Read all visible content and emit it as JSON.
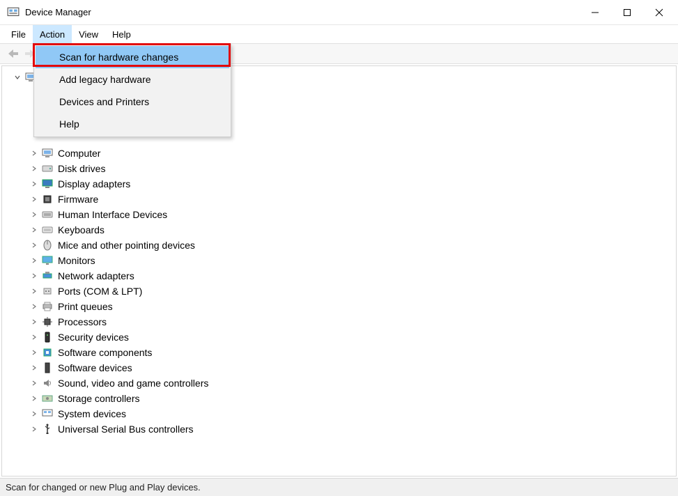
{
  "window": {
    "title": "Device Manager"
  },
  "menubar": {
    "items": [
      "File",
      "Action",
      "View",
      "Help"
    ],
    "active_index": 1
  },
  "dropdown": {
    "items": [
      {
        "label": "Scan for hardware changes",
        "highlighted": true
      },
      {
        "label": "Add legacy hardware",
        "highlighted": false
      },
      {
        "label": "Devices and Printers",
        "highlighted": false
      },
      {
        "label": "Help",
        "highlighted": false
      }
    ]
  },
  "tree": {
    "root": {
      "label": ""
    },
    "nodes": [
      {
        "label": "",
        "hidden": true
      },
      {
        "label": "",
        "hidden": true
      },
      {
        "label": "",
        "hidden": true
      },
      {
        "label": "",
        "hidden": true
      },
      {
        "label": "Computer",
        "icon": "computer"
      },
      {
        "label": "Disk drives",
        "icon": "disk"
      },
      {
        "label": "Display adapters",
        "icon": "display"
      },
      {
        "label": "Firmware",
        "icon": "firmware"
      },
      {
        "label": "Human Interface Devices",
        "icon": "hid"
      },
      {
        "label": "Keyboards",
        "icon": "keyboard"
      },
      {
        "label": "Mice and other pointing devices",
        "icon": "mouse"
      },
      {
        "label": "Monitors",
        "icon": "monitor"
      },
      {
        "label": "Network adapters",
        "icon": "network"
      },
      {
        "label": "Ports (COM & LPT)",
        "icon": "port"
      },
      {
        "label": "Print queues",
        "icon": "printer"
      },
      {
        "label": "Processors",
        "icon": "cpu"
      },
      {
        "label": "Security devices",
        "icon": "security"
      },
      {
        "label": "Software components",
        "icon": "software"
      },
      {
        "label": "Software devices",
        "icon": "software2"
      },
      {
        "label": "Sound, video and game controllers",
        "icon": "sound"
      },
      {
        "label": "Storage controllers",
        "icon": "storage"
      },
      {
        "label": "System devices",
        "icon": "system"
      },
      {
        "label": "Universal Serial Bus controllers",
        "icon": "usb"
      }
    ]
  },
  "statusbar": {
    "text": "Scan for changed or new Plug and Play devices."
  }
}
